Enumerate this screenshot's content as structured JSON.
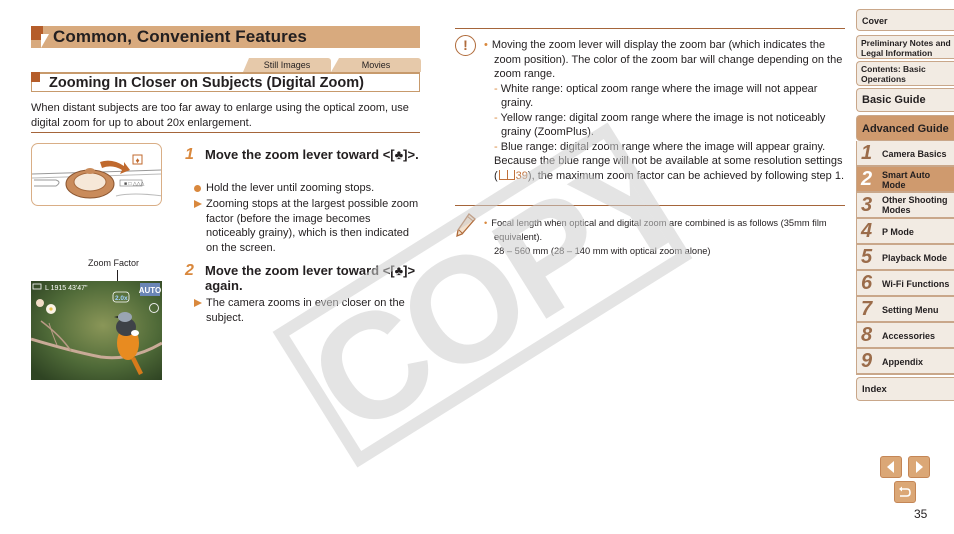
{
  "header": {
    "page_title": "Common, Convenient Features",
    "tabs": [
      "Still Images",
      "Movies"
    ],
    "section_title": "Zooming In Closer on Subjects (Digital Zoom)"
  },
  "intro": "When distant subjects are too far away to enlarge using the optical zoom, use digital zoom for up to about 20x enlargement.",
  "illustrations": {
    "zoom_factor_label": "Zoom Factor",
    "lever_symbol": "[♣]",
    "screen_readout": "L  1915  43'47\"",
    "screen_mode": "AUTO",
    "screen_zoom": "2.0x"
  },
  "steps": [
    {
      "number": "1",
      "heading": "Move the zoom lever toward <[♣]>.",
      "items": [
        {
          "type": "dot",
          "text": "Hold the lever until zooming stops."
        },
        {
          "type": "arrow",
          "text": "Zooming stops at the largest possible zoom factor (before the image becomes noticeably grainy), which is then indicated on the screen."
        }
      ]
    },
    {
      "number": "2",
      "heading": "Move the zoom lever toward <[♣]> again.",
      "items": [
        {
          "type": "arrow",
          "text": "The camera zooms in even closer on the subject."
        }
      ]
    }
  ],
  "caution": {
    "bullet": "Moving the zoom lever will display the zoom bar (which indicates the zoom position). The color of the zoom bar will change depending on the zoom range.",
    "ranges": [
      "White range: optical zoom range where the image will not appear grainy.",
      "Yellow range: digital zoom range where the image is not noticeably grainy (ZoomPlus).",
      "Blue range: digital zoom range where the image will appear grainy."
    ],
    "follow_before": "Because the blue range will not be available at some resolution settings (",
    "follow_ref": "39",
    "follow_after": "), the maximum zoom factor can be achieved by following step 1."
  },
  "note": {
    "bullet": "Focal length when optical and digital zoom are combined is as follows (35mm film equivalent).",
    "detail": "28 – 560 mm (28 – 140 mm with optical zoom alone)"
  },
  "watermark": "COPY",
  "sidebar": {
    "top_items": [
      {
        "label": "Cover"
      },
      {
        "label": "Preliminary Notes and Legal Information"
      },
      {
        "label": "Contents: Basic Operations"
      },
      {
        "label": "Basic Guide"
      },
      {
        "label": "Advanced Guide",
        "active": true
      }
    ],
    "chapters": [
      {
        "num": "1",
        "label": "Camera Basics"
      },
      {
        "num": "2",
        "label": "Smart Auto Mode",
        "active": true
      },
      {
        "num": "3",
        "label": "Other Shooting Modes"
      },
      {
        "num": "4",
        "label": "P Mode"
      },
      {
        "num": "5",
        "label": "Playback Mode"
      },
      {
        "num": "6",
        "label": "Wi-Fi Functions"
      },
      {
        "num": "7",
        "label": "Setting Menu"
      },
      {
        "num": "8",
        "label": "Accessories"
      },
      {
        "num": "9",
        "label": "Appendix"
      }
    ],
    "index_label": "Index"
  },
  "footer": {
    "page_number": "35",
    "accent_color": "#dba776"
  }
}
